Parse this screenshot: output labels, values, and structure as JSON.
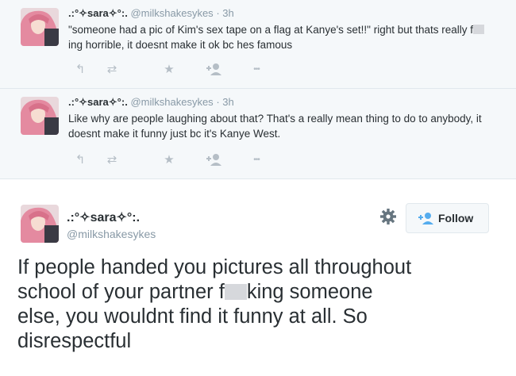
{
  "tweets": [
    {
      "name": ".:°✧sara✧°:.",
      "handle": "@milkshakesykes",
      "time": "· 3h",
      "text_before": "\"someone had a pic of Kim's sex tape on a flag at Kanye's set!!\" right but thats really f",
      "text_after": "ing horrible, it doesnt make it ok bc hes famous"
    },
    {
      "name": ".:°✧sara✧°:.",
      "handle": "@milkshakesykes",
      "time": "· 3h",
      "text": "Like why are people laughing about that? That's a really mean thing to do to anybody, it doesnt make it funny just bc it's Kanye West."
    }
  ],
  "icons": [
    "reply-icon",
    "retweet-icon",
    "favorite-icon",
    "follow-icon",
    "more-icon"
  ],
  "action_glyphs": {
    "reply": "↰",
    "retweet": "⇄",
    "favorite": "★",
    "more": "•••"
  },
  "main_tweet": {
    "name": ".:°✧sara✧°:.",
    "handle": "@milkshakesykes",
    "follow_label": "Follow",
    "text_line1": "If people handed you pictures all throughout",
    "text_line2_before": "school of your partner f",
    "text_line2_after": "king someone",
    "text_line3": "else, you wouldnt find it funny at all. So",
    "text_line4": "disrespectful"
  },
  "colors": {
    "accent": "#55acee",
    "muted": "#8899a6",
    "icon": "#b5bec6",
    "bg": "#f5f8fa"
  }
}
